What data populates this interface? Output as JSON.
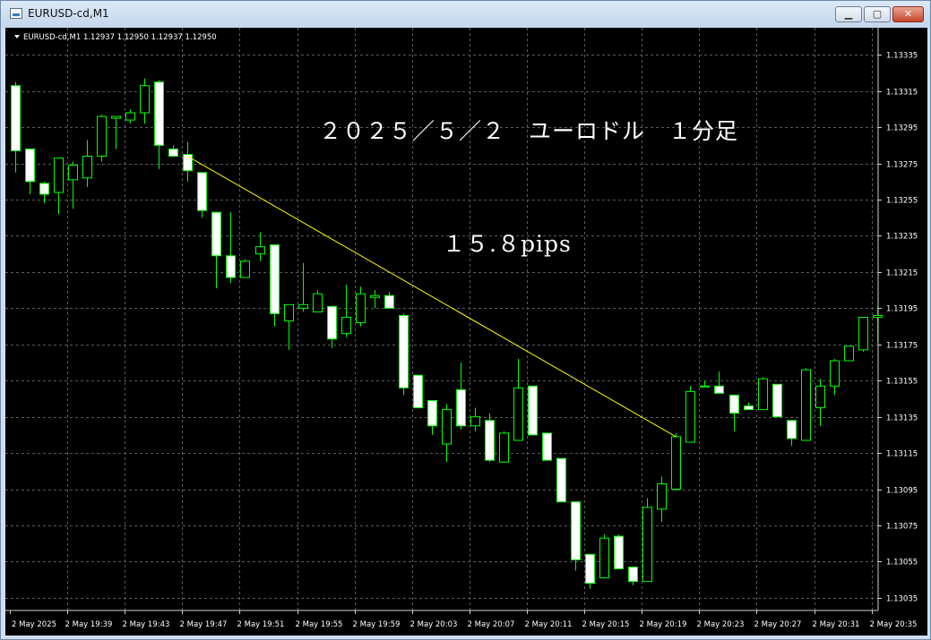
{
  "window": {
    "title": "EURUSD-cd,M1",
    "min_glyph": "▁",
    "max_glyph": "▢",
    "close_glyph": "✕"
  },
  "chart_header": {
    "text": "EURUSD-cd,M1  1.12937 1.12950 1.12937 1.12950"
  },
  "annotations": {
    "title": "２０２５／５／２　ユーロドル　１分足",
    "pips": "１５.８pips"
  },
  "colors": {
    "background": "#000000",
    "grid": "#5a5a5a",
    "bull_body": "#000000",
    "bear_body": "#ffffff",
    "candle_outline": "#00ff00",
    "trendline": "#ffff00",
    "text": "#ffffff"
  },
  "chart_data": {
    "type": "candlestick",
    "symbol": "EURUSD-cd",
    "timeframe": "M1",
    "ylim": [
      1.13028,
      1.1335
    ],
    "y_ticks": [
      "1.13335",
      "1.13315",
      "1.13295",
      "1.13275",
      "1.13255",
      "1.13235",
      "1.13215",
      "1.13195",
      "1.13175",
      "1.13155",
      "1.13135",
      "1.13115",
      "1.13095",
      "1.13075",
      "1.13055",
      "1.13035"
    ],
    "x_tick_labels": [
      "2 May 2025",
      "2 May 19:39",
      "2 May 19:43",
      "2 May 19:47",
      "2 May 19:51",
      "2 May 19:55",
      "2 May 19:59",
      "2 May 20:03",
      "2 May 20:07",
      "2 May 20:11",
      "2 May 20:15",
      "2 May 20:19",
      "2 May 20:23",
      "2 May 20:27",
      "2 May 20:31",
      "2 May 20:35"
    ],
    "grid": true,
    "candles": [
      {
        "o": 1.13318,
        "h": 1.1332,
        "c": 1.13282,
        "l": 1.1327
      },
      {
        "o": 1.13283,
        "h": 1.13283,
        "c": 1.13265,
        "l": 1.13258
      },
      {
        "o": 1.13264,
        "h": 1.13265,
        "c": 1.13258,
        "l": 1.13253
      },
      {
        "o": 1.13259,
        "h": 1.13278,
        "c": 1.13278,
        "l": 1.13247
      },
      {
        "o": 1.13266,
        "h": 1.13276,
        "c": 1.13274,
        "l": 1.1325
      },
      {
        "o": 1.13267,
        "h": 1.13288,
        "c": 1.13279,
        "l": 1.13262
      },
      {
        "o": 1.13279,
        "h": 1.13302,
        "c": 1.13301,
        "l": 1.13276
      },
      {
        "o": 1.133,
        "h": 1.13301,
        "c": 1.13301,
        "l": 1.13283
      },
      {
        "o": 1.13299,
        "h": 1.13305,
        "c": 1.13303,
        "l": 1.13297
      },
      {
        "o": 1.13303,
        "h": 1.13322,
        "c": 1.13318,
        "l": 1.13297
      },
      {
        "o": 1.1332,
        "h": 1.13321,
        "c": 1.13285,
        "l": 1.13272
      },
      {
        "o": 1.13283,
        "h": 1.13285,
        "c": 1.13279,
        "l": 1.13279
      },
      {
        "o": 1.1328,
        "h": 1.13287,
        "c": 1.13271,
        "l": 1.13265
      },
      {
        "o": 1.1327,
        "h": 1.1327,
        "c": 1.13249,
        "l": 1.13245
      },
      {
        "o": 1.13248,
        "h": 1.13248,
        "c": 1.13224,
        "l": 1.13206
      },
      {
        "o": 1.13224,
        "h": 1.13248,
        "c": 1.13212,
        "l": 1.13209
      },
      {
        "o": 1.13212,
        "h": 1.13222,
        "c": 1.13221,
        "l": 1.13212
      },
      {
        "o": 1.13225,
        "h": 1.13237,
        "c": 1.13229,
        "l": 1.13221
      },
      {
        "o": 1.1323,
        "h": 1.1323,
        "c": 1.13192,
        "l": 1.13185
      },
      {
        "o": 1.13188,
        "h": 1.13197,
        "c": 1.13197,
        "l": 1.13172
      },
      {
        "o": 1.13195,
        "h": 1.1322,
        "c": 1.13197,
        "l": 1.13193
      },
      {
        "o": 1.13193,
        "h": 1.13205,
        "c": 1.13203,
        "l": 1.13193
      },
      {
        "o": 1.13196,
        "h": 1.13196,
        "c": 1.13178,
        "l": 1.13173
      },
      {
        "o": 1.13181,
        "h": 1.13208,
        "c": 1.1319,
        "l": 1.13179
      },
      {
        "o": 1.13187,
        "h": 1.13207,
        "c": 1.13203,
        "l": 1.13185
      },
      {
        "o": 1.13201,
        "h": 1.13205,
        "c": 1.13202,
        "l": 1.13195
      },
      {
        "o": 1.13202,
        "h": 1.13204,
        "c": 1.13195,
        "l": 1.13195
      },
      {
        "o": 1.13191,
        "h": 1.13192,
        "c": 1.13151,
        "l": 1.13147
      },
      {
        "o": 1.13158,
        "h": 1.13158,
        "c": 1.1314,
        "l": 1.1314
      },
      {
        "o": 1.13144,
        "h": 1.13144,
        "c": 1.1313,
        "l": 1.13125
      },
      {
        "o": 1.1312,
        "h": 1.13142,
        "c": 1.13139,
        "l": 1.1311
      },
      {
        "o": 1.1315,
        "h": 1.13165,
        "c": 1.1313,
        "l": 1.13128
      },
      {
        "o": 1.1313,
        "h": 1.1314,
        "c": 1.13135,
        "l": 1.13127
      },
      {
        "o": 1.13133,
        "h": 1.13137,
        "c": 1.13111,
        "l": 1.1311
      },
      {
        "o": 1.1311,
        "h": 1.13127,
        "c": 1.13126,
        "l": 1.1311
      },
      {
        "o": 1.13122,
        "h": 1.13167,
        "c": 1.13151,
        "l": 1.13122
      },
      {
        "o": 1.13152,
        "h": 1.13152,
        "c": 1.13125,
        "l": 1.13125
      },
      {
        "o": 1.13126,
        "h": 1.13126,
        "c": 1.13111,
        "l": 1.13111
      },
      {
        "o": 1.13112,
        "h": 1.13112,
        "c": 1.13088,
        "l": 1.13088
      },
      {
        "o": 1.13088,
        "h": 1.13088,
        "c": 1.13056,
        "l": 1.1305
      },
      {
        "o": 1.13059,
        "h": 1.13059,
        "c": 1.13043,
        "l": 1.1304
      },
      {
        "o": 1.13046,
        "h": 1.1307,
        "c": 1.13068,
        "l": 1.13046
      },
      {
        "o": 1.13069,
        "h": 1.1307,
        "c": 1.13051,
        "l": 1.13051
      },
      {
        "o": 1.13052,
        "h": 1.13052,
        "c": 1.13044,
        "l": 1.13042
      },
      {
        "o": 1.13044,
        "h": 1.1309,
        "c": 1.13085,
        "l": 1.13044
      },
      {
        "o": 1.13084,
        "h": 1.13102,
        "c": 1.13098,
        "l": 1.13077
      },
      {
        "o": 1.13095,
        "h": 1.13126,
        "c": 1.13124,
        "l": 1.13094
      },
      {
        "o": 1.13121,
        "h": 1.13152,
        "c": 1.13149,
        "l": 1.13121
      },
      {
        "o": 1.13152,
        "h": 1.13155,
        "c": 1.13152,
        "l": 1.13152
      },
      {
        "o": 1.13152,
        "h": 1.1316,
        "c": 1.13148,
        "l": 1.13148
      },
      {
        "o": 1.13147,
        "h": 1.13147,
        "c": 1.13137,
        "l": 1.13127
      },
      {
        "o": 1.13141,
        "h": 1.13143,
        "c": 1.13139,
        "l": 1.13139
      },
      {
        "o": 1.13139,
        "h": 1.13157,
        "c": 1.13156,
        "l": 1.13139
      },
      {
        "o": 1.13153,
        "h": 1.13153,
        "c": 1.13135,
        "l": 1.13135
      },
      {
        "o": 1.13133,
        "h": 1.13133,
        "c": 1.13123,
        "l": 1.13119
      },
      {
        "o": 1.13122,
        "h": 1.13162,
        "c": 1.13161,
        "l": 1.13122
      },
      {
        "o": 1.1314,
        "h": 1.13156,
        "c": 1.13152,
        "l": 1.1313
      },
      {
        "o": 1.13152,
        "h": 1.13167,
        "c": 1.13166,
        "l": 1.13147
      },
      {
        "o": 1.13166,
        "h": 1.13174,
        "c": 1.13174,
        "l": 1.13166
      },
      {
        "o": 1.13172,
        "h": 1.1319,
        "c": 1.1319,
        "l": 1.13171
      },
      {
        "o": 1.1319,
        "h": 1.13196,
        "c": 1.13191,
        "l": 1.13176
      }
    ],
    "trendline": {
      "from": {
        "candle": 12,
        "price": 1.13279
      },
      "to": {
        "candle": 46,
        "price": 1.13124
      }
    }
  }
}
